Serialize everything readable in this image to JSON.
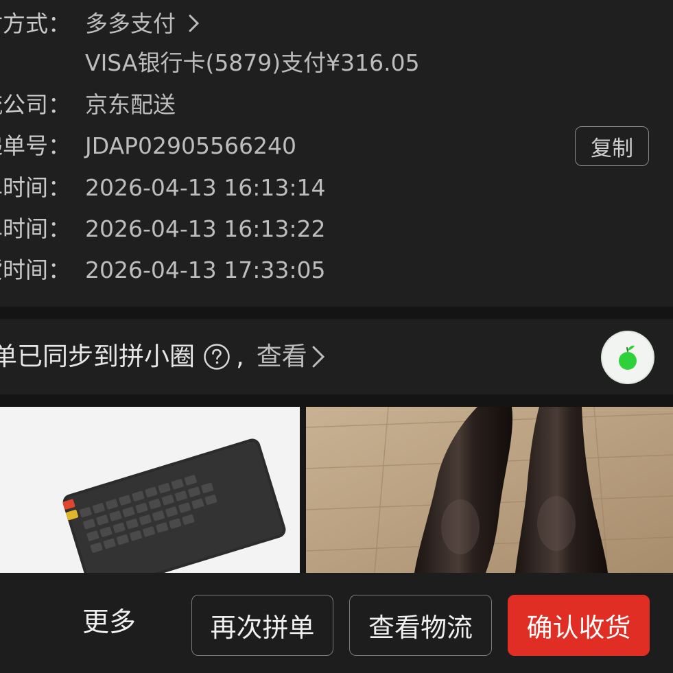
{
  "order_info": {
    "payment_label": "付方式：",
    "payment_value": "多多支付",
    "payment_detail": "VISA银行卡(5879)支付¥316.05",
    "logistics_label": "流公司：",
    "logistics_value": "京东配送",
    "tracking_label": "递单号：",
    "tracking_value": "JDAP02905566240",
    "copy_label": "复制",
    "order_time_label": "单时间：",
    "order_time_value": "2026-04-13 16:13:14",
    "group_time_label": "单时间：",
    "group_time_value": "2026-04-13 16:13:22",
    "ship_time_label": "货时间：",
    "ship_time_value": "2026-04-13 17:33:05"
  },
  "sync_banner": {
    "text": "单已同步到拼小圈",
    "comma": ",",
    "view_label": "查看"
  },
  "bottom_bar": {
    "more_label": "更多",
    "rebuy_label": "再次拼单",
    "track_label": "查看物流",
    "confirm_label": "确认收货"
  },
  "colors": {
    "background": "#1f1f1f",
    "accent_red": "#e02e24",
    "avatar_green": "#2fd13a"
  },
  "icons": [
    "chevron-right-icon",
    "question-circle-icon",
    "apple-avatar-icon"
  ]
}
